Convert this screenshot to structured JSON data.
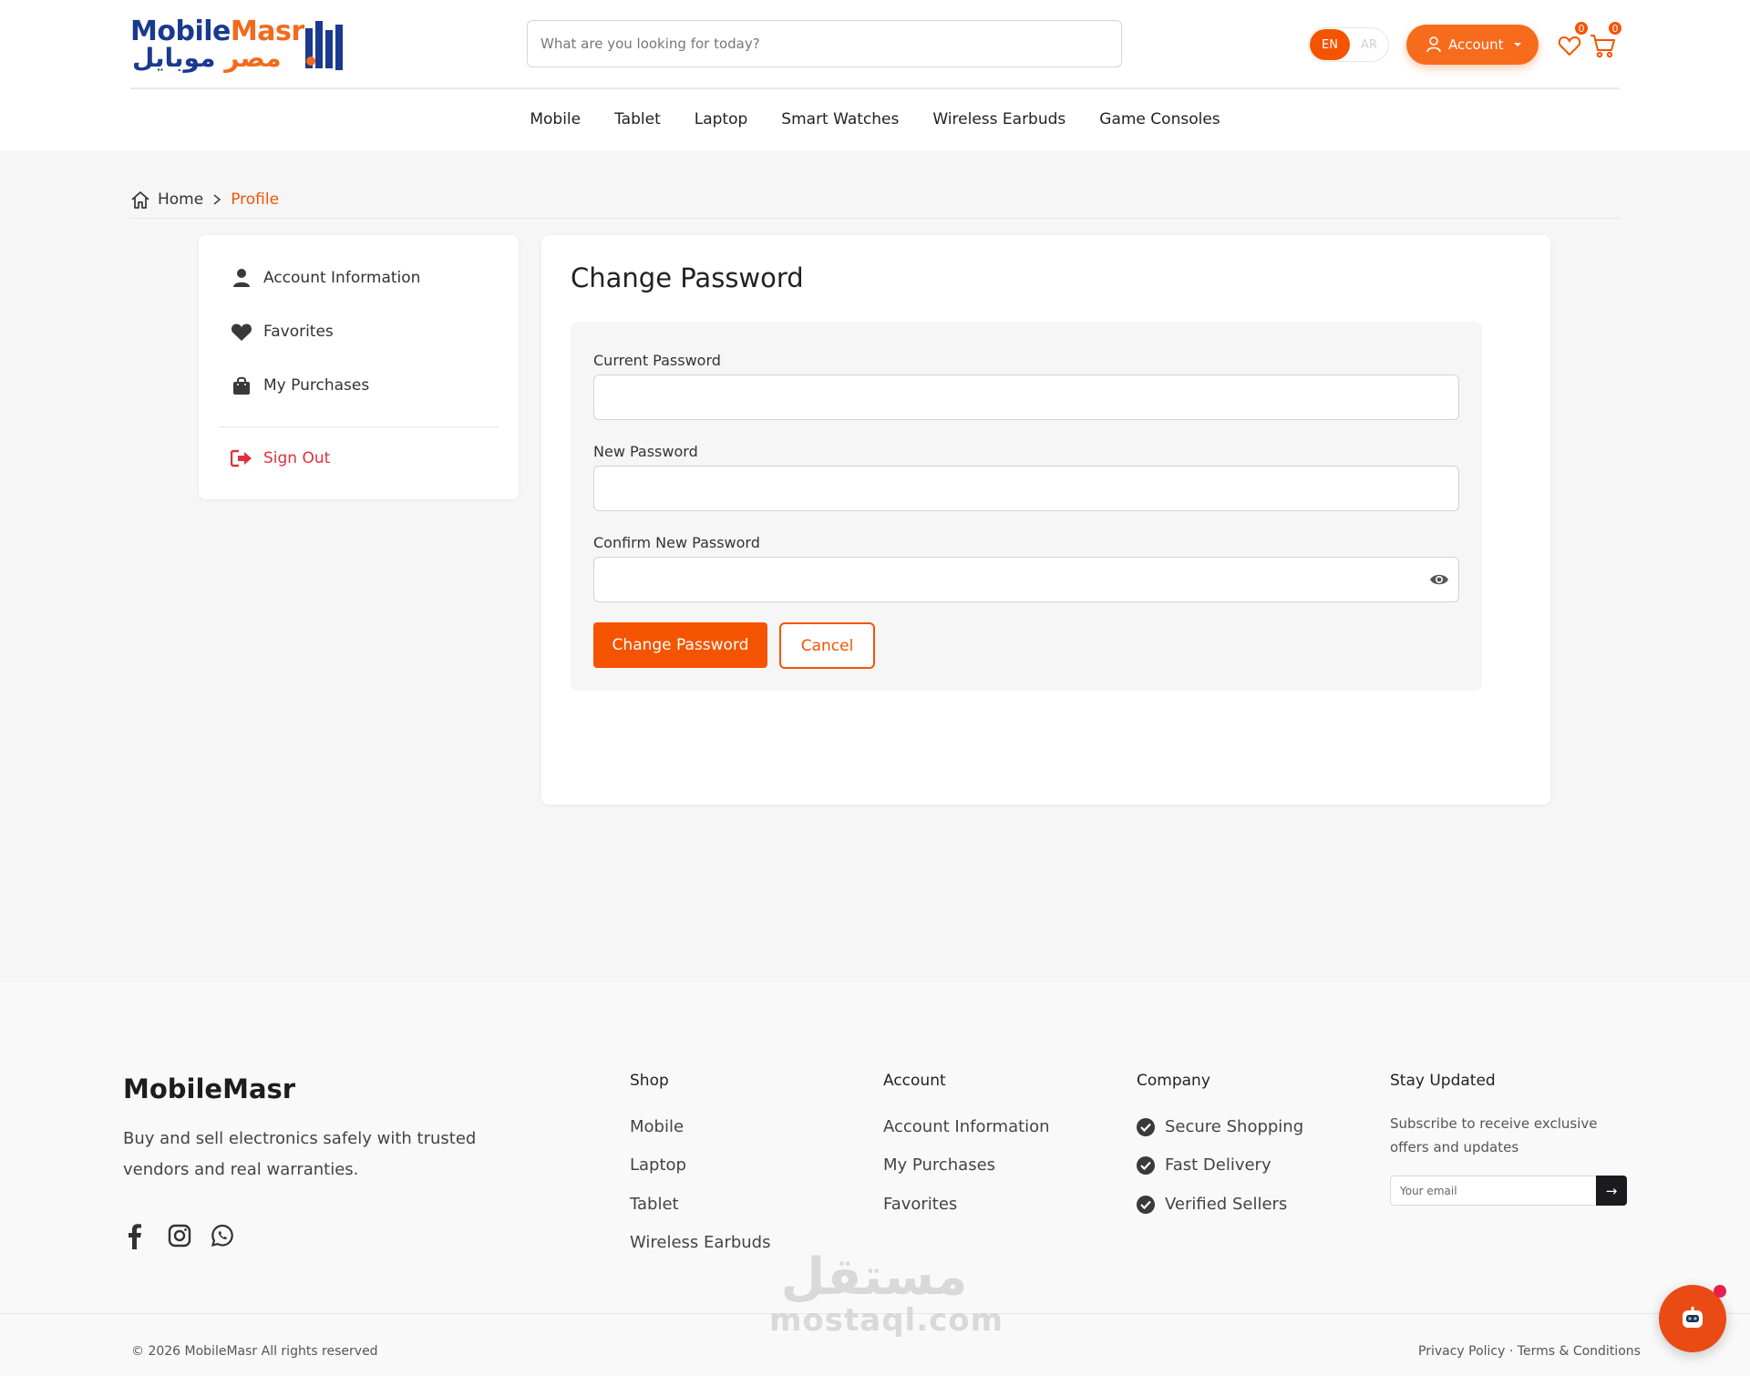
{
  "header": {
    "logo_en_part1": "Mobile",
    "logo_en_part2": "Masr",
    "logo_ar_part1": "موبايل",
    "logo_ar_part2": "مصر",
    "search_placeholder": "What are you looking for today?",
    "lang_en": "EN",
    "lang_ar": "AR",
    "account_label": "Account",
    "favorites_count": "0",
    "cart_count": "0",
    "accent_color": "#f45400"
  },
  "nav": {
    "items": [
      "Mobile",
      "Tablet",
      "Laptop",
      "Smart Watches",
      "Wireless Earbuds",
      "Game Consoles"
    ]
  },
  "breadcrumb": {
    "home": "Home",
    "current": "Profile"
  },
  "sidebar": {
    "items": [
      {
        "label": "Account Information",
        "icon": "user-icon"
      },
      {
        "label": "Favorites",
        "icon": "heart-icon"
      },
      {
        "label": "My Purchases",
        "icon": "shopping-bag-icon"
      }
    ],
    "signout": {
      "label": "Sign Out",
      "icon": "sign-out-icon"
    }
  },
  "main": {
    "title": "Change Password",
    "fields": [
      {
        "label": "Current Password",
        "value": ""
      },
      {
        "label": "New Password",
        "value": ""
      },
      {
        "label": "Confirm New Password",
        "value": ""
      }
    ],
    "submit_label": "Change Password",
    "cancel_label": "Cancel"
  },
  "footer": {
    "brand": "MobileMasr",
    "description": "Buy and sell electronics safely with trusted vendors and real warranties.",
    "social_icons": [
      "facebook-icon",
      "instagram-icon",
      "whatsapp-icon"
    ],
    "shop": {
      "title": "Shop",
      "links": [
        "Mobile",
        "Laptop",
        "Tablet",
        "Wireless Earbuds"
      ]
    },
    "account": {
      "title": "Account",
      "links": [
        "Account Information",
        "My Purchases",
        "Favorites"
      ]
    },
    "company": {
      "title": "Company",
      "items": [
        "Secure Shopping",
        "Fast Delivery",
        "Verified Sellers"
      ]
    },
    "newsletter": {
      "title": "Stay Updated",
      "description": "Subscribe to receive exclusive offers and updates",
      "placeholder": "Your email",
      "send_symbol": "→"
    },
    "copyright": "© 2026 MobileMasr All rights reserved",
    "privacy": "Privacy Policy",
    "legal_separator": "·",
    "terms": "Terms & Conditions"
  },
  "watermark": {
    "ar": "مستقل",
    "en": "mostaql.com"
  }
}
